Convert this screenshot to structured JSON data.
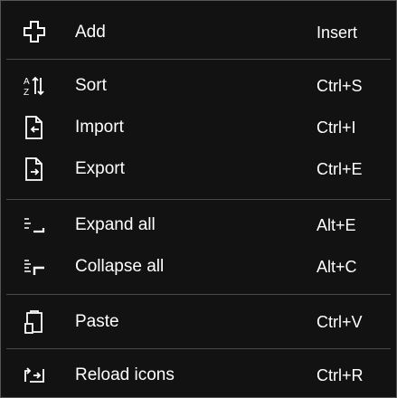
{
  "menu": {
    "items": [
      {
        "id": "add",
        "icon": "add-icon",
        "label": "Add",
        "shortcut": "Insert"
      },
      {
        "id": "sort",
        "icon": "sort-icon",
        "label": "Sort",
        "shortcut": "Ctrl+S"
      },
      {
        "id": "import",
        "icon": "import-icon",
        "label": "Import",
        "shortcut": "Ctrl+I"
      },
      {
        "id": "export",
        "icon": "export-icon",
        "label": "Export",
        "shortcut": "Ctrl+E"
      },
      {
        "id": "expand-all",
        "icon": "expand-all-icon",
        "label": "Expand all",
        "shortcut": "Alt+E"
      },
      {
        "id": "collapse-all",
        "icon": "collapse-all-icon",
        "label": "Collapse all",
        "shortcut": "Alt+C"
      },
      {
        "id": "paste",
        "icon": "paste-icon",
        "label": "Paste",
        "shortcut": "Ctrl+V"
      },
      {
        "id": "reload-icons",
        "icon": "reload-icon",
        "label": "Reload icons",
        "shortcut": "Ctrl+R"
      }
    ]
  },
  "colors": {
    "background": "#121212",
    "border": "#565656",
    "separator": "#4a4a4a",
    "text": "#ffffff"
  }
}
